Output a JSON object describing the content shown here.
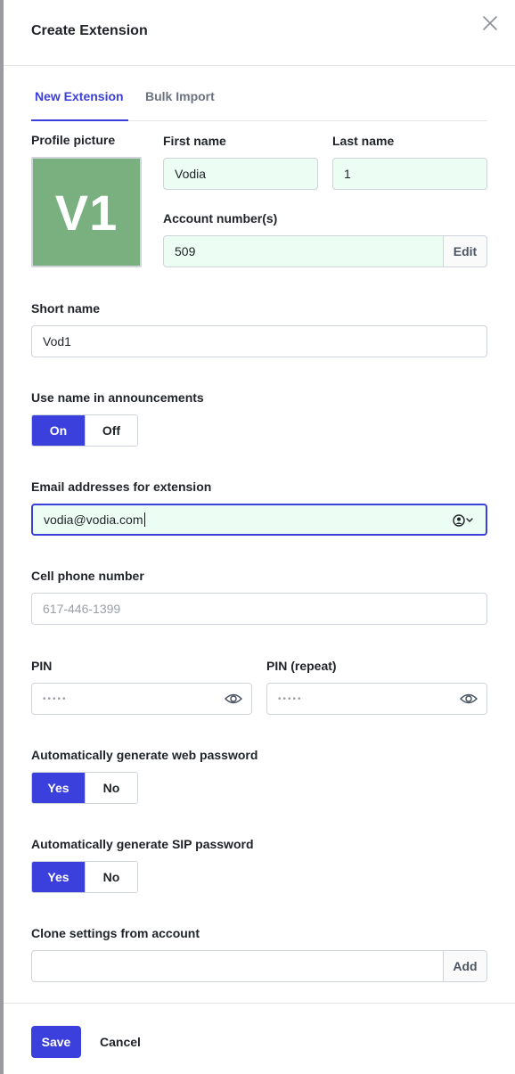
{
  "dialog": {
    "title": "Create Extension",
    "close_icon": "close-icon"
  },
  "tabs": [
    {
      "label": "New Extension",
      "active": true
    },
    {
      "label": "Bulk Import",
      "active": false
    }
  ],
  "profile": {
    "label": "Profile picture",
    "initials": "V1",
    "color": "#7aaf7f"
  },
  "first_name": {
    "label": "First name",
    "value": "Vodia"
  },
  "last_name": {
    "label": "Last name",
    "value": "1"
  },
  "account_numbers": {
    "label": "Account number(s)",
    "value": "509",
    "button": "Edit"
  },
  "short_name": {
    "label": "Short name",
    "value": "Vod1"
  },
  "use_name": {
    "label": "Use name in announcements",
    "options": [
      "On",
      "Off"
    ],
    "selected": "On"
  },
  "email": {
    "label": "Email addresses for extension",
    "value": "vodia@vodia.com",
    "icon": "contact-dropdown-icon"
  },
  "cell_phone": {
    "label": "Cell phone number",
    "placeholder": "617-446-1399",
    "value": ""
  },
  "pin": {
    "label": "PIN",
    "masked": "•••••",
    "icon": "eye-icon"
  },
  "pin_repeat": {
    "label": "PIN (repeat)",
    "masked": "•••••",
    "icon": "eye-icon"
  },
  "web_password": {
    "label": "Automatically generate web password",
    "options": [
      "Yes",
      "No"
    ],
    "selected": "Yes"
  },
  "sip_password": {
    "label": "Automatically generate SIP password",
    "options": [
      "Yes",
      "No"
    ],
    "selected": "Yes"
  },
  "clone": {
    "label": "Clone settings from account",
    "value": "",
    "button": "Add"
  },
  "footer": {
    "save": "Save",
    "cancel": "Cancel"
  },
  "colors": {
    "accent": "#3b3fdc",
    "filled_bg": "#ecfdf3"
  }
}
